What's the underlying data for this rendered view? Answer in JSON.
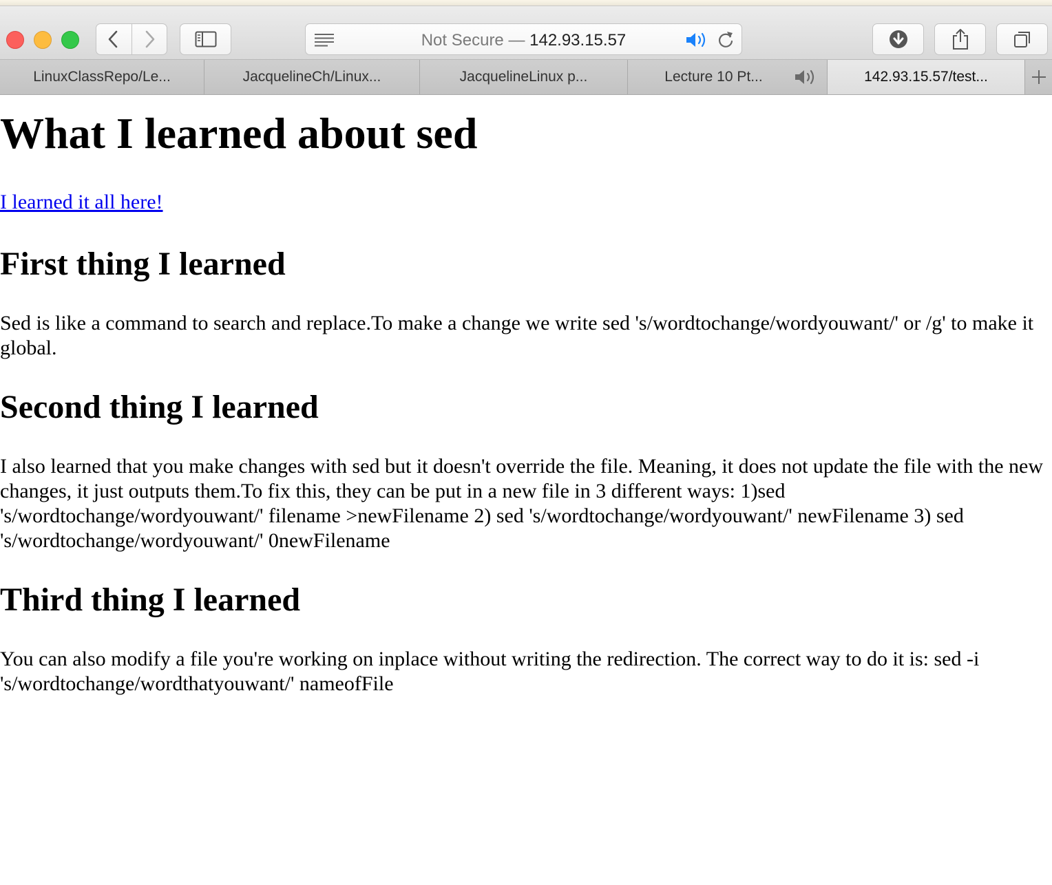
{
  "browser": {
    "address": {
      "security_label": "Not Secure —",
      "host": "142.93.15.57"
    },
    "tabs": [
      {
        "label": "LinuxClassRepo/Le..."
      },
      {
        "label": "JacquelineCh/Linux..."
      },
      {
        "label": "JacquelineLinux p..."
      },
      {
        "label": "Lecture 10 Pt..."
      },
      {
        "label": "142.93.15.57/test..."
      }
    ],
    "icons": {
      "close": "close-button",
      "minimize": "minimize-button",
      "zoom": "zoom-button",
      "back": "chevron-left-icon",
      "forward": "chevron-right-icon",
      "sidebar": "sidebar-icon",
      "reader": "reader-icon",
      "audio": "speaker-icon",
      "reload": "reload-icon",
      "downloads": "download-icon",
      "share": "share-icon",
      "tabs_overview": "tabs-icon",
      "new_tab": "plus-icon"
    },
    "colors": {
      "audio_active": "#1a82fb",
      "link": "#0000ee"
    }
  },
  "page": {
    "title": "What I learned about sed",
    "link_text": "I learned it all here!",
    "sections": [
      {
        "heading": "First thing I learned",
        "text": "Sed is like a command to search and replace.To make a change we write sed 's/wordtochange/wordyouwant/' or /g' to make it global."
      },
      {
        "heading": "Second thing I learned",
        "text": "I also learned that you make changes with sed but it doesn't override the file. Meaning, it does not update the file with the new changes, it just outputs them.To fix this, they can be put in a new file in 3 different ways: 1)sed 's/wordtochange/wordyouwant/' filename >newFilename 2) sed 's/wordtochange/wordyouwant/' newFilename 3) sed 's/wordtochange/wordyouwant/' 0newFilename"
      },
      {
        "heading": "Third thing I learned",
        "text": "You can also modify a file you're working on inplace without writing the redirection. The correct way to do it is: sed -i 's/wordtochange/wordthatyouwant/' nameofFile"
      }
    ]
  }
}
